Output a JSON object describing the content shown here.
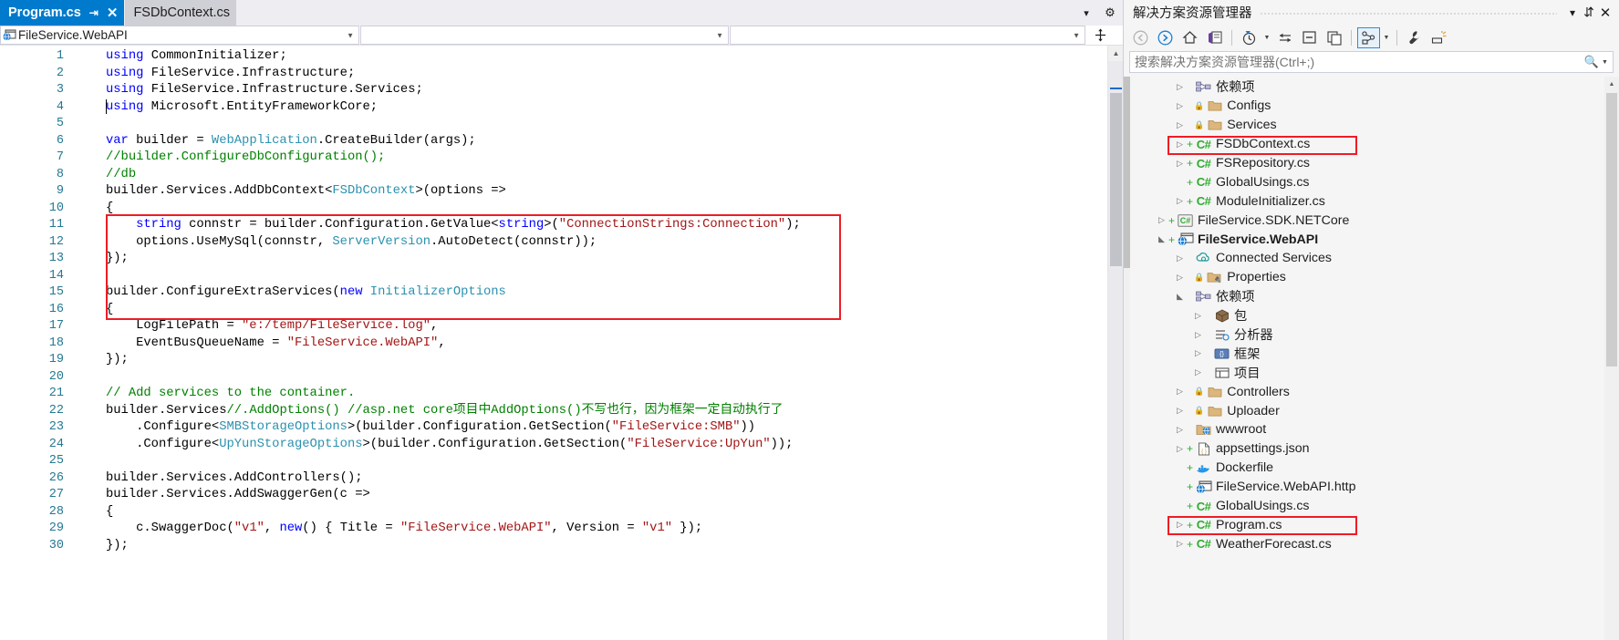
{
  "editor": {
    "tabs": [
      {
        "name": "Program.cs",
        "active": true,
        "pin_icon": "pin-icon",
        "close_icon": "close-icon"
      },
      {
        "name": "FSDbContext.cs",
        "active": false
      }
    ],
    "tabstrip_buttons": [
      {
        "name": "tab-dropdown-button",
        "glyph": "▾"
      },
      {
        "name": "tab-settings-gear-icon",
        "glyph": "⚙"
      }
    ],
    "navbar": {
      "project_selector": "FileService.WebAPI",
      "type_selector": "",
      "member_selector": "",
      "split_window_icon": "split-window-icon"
    },
    "line_numbers": [
      1,
      2,
      3,
      4,
      5,
      6,
      7,
      8,
      9,
      10,
      11,
      12,
      13,
      14,
      15,
      16,
      17,
      18,
      19,
      20,
      21,
      22,
      23,
      24,
      25,
      26,
      27,
      28,
      29,
      30
    ],
    "code_lines": [
      [
        {
          "t": "using ",
          "c": "kw"
        },
        {
          "t": "CommonInitializer;",
          "c": "pln"
        }
      ],
      [
        {
          "t": "using ",
          "c": "kw"
        },
        {
          "t": "FileService.Infrastructure;",
          "c": "pln"
        }
      ],
      [
        {
          "t": "using ",
          "c": "kw"
        },
        {
          "t": "FileService.Infrastructure.Services;",
          "c": "pln"
        }
      ],
      [
        {
          "t": "using ",
          "c": "kw"
        },
        {
          "t": "Microsoft.EntityFrameworkCore;",
          "c": "pln"
        }
      ],
      [],
      [
        {
          "t": "var ",
          "c": "kw"
        },
        {
          "t": "builder = ",
          "c": "pln"
        },
        {
          "t": "WebApplication",
          "c": "typ"
        },
        {
          "t": ".CreateBuilder(args);",
          "c": "pln"
        }
      ],
      [
        {
          "t": "//builder.ConfigureDbConfiguration();",
          "c": "cmt"
        }
      ],
      [
        {
          "t": "//db",
          "c": "cmt"
        }
      ],
      [
        {
          "t": "builder.Services.AddDbContext<",
          "c": "pln"
        },
        {
          "t": "FSDbContext",
          "c": "typ"
        },
        {
          "t": ">(options =>",
          "c": "pln"
        }
      ],
      [
        {
          "t": "{",
          "c": "pln"
        }
      ],
      [
        {
          "t": "    string ",
          "c": "kw"
        },
        {
          "t": "connstr = builder.Configuration.GetValue<",
          "c": "pln"
        },
        {
          "t": "string",
          "c": "kw"
        },
        {
          "t": ">(",
          "c": "pln"
        },
        {
          "t": "\"ConnectionStrings:Connection\"",
          "c": "str"
        },
        {
          "t": ");",
          "c": "pln"
        }
      ],
      [
        {
          "t": "    options.UseMySql(connstr, ",
          "c": "pln"
        },
        {
          "t": "ServerVersion",
          "c": "typ"
        },
        {
          "t": ".AutoDetect(connstr));",
          "c": "pln"
        }
      ],
      [
        {
          "t": "});",
          "c": "pln"
        }
      ],
      [],
      [
        {
          "t": "builder.ConfigureExtraServices(",
          "c": "pln"
        },
        {
          "t": "new ",
          "c": "kw"
        },
        {
          "t": "InitializerOptions",
          "c": "typ"
        }
      ],
      [
        {
          "t": "{",
          "c": "pln"
        }
      ],
      [
        {
          "t": "    LogFilePath = ",
          "c": "pln"
        },
        {
          "t": "\"e:/temp/FileService.log\"",
          "c": "str"
        },
        {
          "t": ",",
          "c": "pln"
        }
      ],
      [
        {
          "t": "    EventBusQueueName = ",
          "c": "pln"
        },
        {
          "t": "\"FileService.WebAPI\"",
          "c": "str"
        },
        {
          "t": ",",
          "c": "pln"
        }
      ],
      [
        {
          "t": "});",
          "c": "pln"
        }
      ],
      [],
      [
        {
          "t": "// Add services to the container.",
          "c": "cmt"
        }
      ],
      [
        {
          "t": "builder.Services",
          "c": "pln"
        },
        {
          "t": "//.AddOptions() //asp.net core项目中AddOptions()不写也行，因为框架一定自动执行了",
          "c": "cmt"
        }
      ],
      [
        {
          "t": "    .Configure<",
          "c": "pln"
        },
        {
          "t": "SMBStorageOptions",
          "c": "typ"
        },
        {
          "t": ">(builder.Configuration.GetSection(",
          "c": "pln"
        },
        {
          "t": "\"FileService:SMB\"",
          "c": "str"
        },
        {
          "t": "))",
          "c": "pln"
        }
      ],
      [
        {
          "t": "    .Configure<",
          "c": "pln"
        },
        {
          "t": "UpYunStorageOptions",
          "c": "typ"
        },
        {
          "t": ">(builder.Configuration.GetSection(",
          "c": "pln"
        },
        {
          "t": "\"FileService:UpYun\"",
          "c": "str"
        },
        {
          "t": "));",
          "c": "pln"
        }
      ],
      [],
      [
        {
          "t": "builder.Services.AddControllers();",
          "c": "pln"
        }
      ],
      [
        {
          "t": "builder.Services.AddSwaggerGen(c =>",
          "c": "pln"
        }
      ],
      [
        {
          "t": "{",
          "c": "pln"
        }
      ],
      [
        {
          "t": "    c.SwaggerDoc(",
          "c": "pln"
        },
        {
          "t": "\"v1\"",
          "c": "str"
        },
        {
          "t": ", ",
          "c": "pln"
        },
        {
          "t": "new",
          "c": "kw"
        },
        {
          "t": "() { Title = ",
          "c": "pln"
        },
        {
          "t": "\"FileService.WebAPI\"",
          "c": "str"
        },
        {
          "t": ", Version = ",
          "c": "pln"
        },
        {
          "t": "\"v1\"",
          "c": "str"
        },
        {
          "t": " });",
          "c": "pln"
        }
      ],
      [
        {
          "t": "});",
          "c": "pln"
        }
      ]
    ],
    "annotation_box_color": "#ee1c25"
  },
  "solution_explorer": {
    "title": "解决方案资源管理器",
    "header_buttons": [
      {
        "name": "se-dropdown-button",
        "glyph": "▾"
      },
      {
        "name": "se-pin-icon",
        "glyph": "⚲"
      },
      {
        "name": "se-close-icon",
        "glyph": "✕"
      }
    ],
    "toolbar_buttons": [
      {
        "name": "back-arrow-icon"
      },
      {
        "name": "forward-arrow-icon"
      },
      {
        "name": "home-icon"
      },
      {
        "name": "sync-with-active-document-icon"
      },
      {
        "name": "pending-changes-filter-icon"
      },
      {
        "name": "refresh-icon"
      },
      {
        "name": "collapse-all-icon"
      },
      {
        "name": "show-all-files-icon"
      },
      {
        "name": "view-code-icon"
      },
      {
        "name": "properties-wrench-icon"
      },
      {
        "name": "preview-selected-items-icon"
      }
    ],
    "search_placeholder": "搜索解决方案资源管理器(Ctrl+;)",
    "tree": [
      {
        "label": "依赖项",
        "indent": 2,
        "expander": "collapsed",
        "icon": "dependencies-icon",
        "plus": false,
        "lock": false,
        "bold": false,
        "highlight": false
      },
      {
        "label": "Configs",
        "indent": 2,
        "expander": "collapsed",
        "icon": "folder-icon",
        "plus": false,
        "lock": true,
        "bold": false,
        "highlight": false
      },
      {
        "label": "Services",
        "indent": 2,
        "expander": "collapsed",
        "icon": "folder-icon",
        "plus": false,
        "lock": true,
        "bold": false,
        "highlight": false
      },
      {
        "label": "FSDbContext.cs",
        "indent": 2,
        "expander": "collapsed",
        "icon": "csharp-file-icon",
        "plus": true,
        "lock": false,
        "bold": false,
        "highlight": true
      },
      {
        "label": "FSRepository.cs",
        "indent": 2,
        "expander": "collapsed",
        "icon": "csharp-file-icon",
        "plus": true,
        "lock": false,
        "bold": false,
        "highlight": false
      },
      {
        "label": "GlobalUsings.cs",
        "indent": 2,
        "expander": "none",
        "icon": "csharp-file-icon",
        "plus": true,
        "lock": false,
        "bold": false,
        "highlight": false
      },
      {
        "label": "ModuleInitializer.cs",
        "indent": 2,
        "expander": "collapsed",
        "icon": "csharp-file-icon",
        "plus": true,
        "lock": false,
        "bold": false,
        "highlight": false
      },
      {
        "label": "FileService.SDK.NETCore",
        "indent": 1,
        "expander": "collapsed",
        "icon": "csharp-project-icon",
        "plus": true,
        "lock": false,
        "bold": false,
        "highlight": false
      },
      {
        "label": "FileService.WebAPI",
        "indent": 1,
        "expander": "expanded",
        "icon": "web-project-icon",
        "plus": true,
        "lock": false,
        "bold": true,
        "highlight": false
      },
      {
        "label": "Connected Services",
        "indent": 2,
        "expander": "collapsed",
        "icon": "connected-services-icon",
        "plus": false,
        "lock": false,
        "bold": false,
        "highlight": false
      },
      {
        "label": "Properties",
        "indent": 2,
        "expander": "collapsed",
        "icon": "properties-folder-icon",
        "plus": false,
        "lock": true,
        "bold": false,
        "highlight": false
      },
      {
        "label": "依赖项",
        "indent": 2,
        "expander": "expanded",
        "icon": "dependencies-icon",
        "plus": false,
        "lock": false,
        "bold": false,
        "highlight": false
      },
      {
        "label": "包",
        "indent": 3,
        "expander": "collapsed",
        "icon": "package-icon",
        "plus": false,
        "lock": false,
        "bold": false,
        "highlight": false
      },
      {
        "label": "分析器",
        "indent": 3,
        "expander": "collapsed",
        "icon": "analyzers-icon",
        "plus": false,
        "lock": false,
        "bold": false,
        "highlight": false
      },
      {
        "label": "框架",
        "indent": 3,
        "expander": "collapsed",
        "icon": "frameworks-icon",
        "plus": false,
        "lock": false,
        "bold": false,
        "highlight": false
      },
      {
        "label": "项目",
        "indent": 3,
        "expander": "collapsed",
        "icon": "projects-icon",
        "plus": false,
        "lock": false,
        "bold": false,
        "highlight": false
      },
      {
        "label": "Controllers",
        "indent": 2,
        "expander": "collapsed",
        "icon": "folder-icon",
        "plus": false,
        "lock": true,
        "bold": false,
        "highlight": false
      },
      {
        "label": "Uploader",
        "indent": 2,
        "expander": "collapsed",
        "icon": "folder-icon",
        "plus": false,
        "lock": true,
        "bold": false,
        "highlight": false
      },
      {
        "label": "wwwroot",
        "indent": 2,
        "expander": "collapsed",
        "icon": "wwwroot-icon",
        "plus": false,
        "lock": false,
        "bold": false,
        "highlight": false
      },
      {
        "label": "appsettings.json",
        "indent": 2,
        "expander": "collapsed",
        "icon": "json-file-icon",
        "plus": true,
        "lock": false,
        "bold": false,
        "highlight": false
      },
      {
        "label": "Dockerfile",
        "indent": 2,
        "expander": "none",
        "icon": "docker-icon",
        "plus": true,
        "lock": false,
        "bold": false,
        "highlight": false
      },
      {
        "label": "FileService.WebAPI.http",
        "indent": 2,
        "expander": "none",
        "icon": "http-file-icon",
        "plus": true,
        "lock": false,
        "bold": false,
        "highlight": false
      },
      {
        "label": "GlobalUsings.cs",
        "indent": 2,
        "expander": "none",
        "icon": "csharp-file-icon",
        "plus": true,
        "lock": false,
        "bold": false,
        "highlight": false
      },
      {
        "label": "Program.cs",
        "indent": 2,
        "expander": "collapsed",
        "icon": "csharp-file-icon",
        "plus": true,
        "lock": false,
        "bold": false,
        "highlight": true
      },
      {
        "label": "WeatherForecast.cs",
        "indent": 2,
        "expander": "collapsed",
        "icon": "csharp-file-icon",
        "plus": true,
        "lock": false,
        "bold": false,
        "highlight": false
      }
    ]
  }
}
